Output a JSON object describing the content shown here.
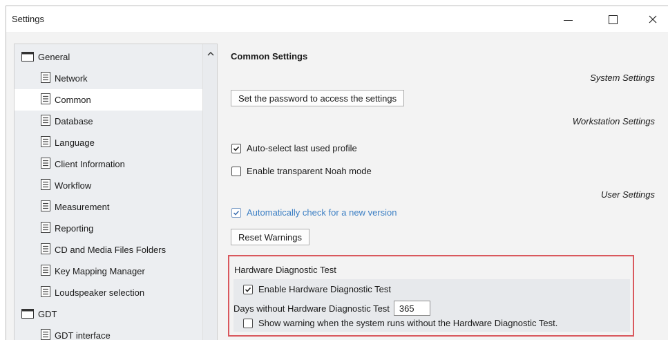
{
  "window": {
    "title": "Settings"
  },
  "tree": {
    "items": [
      {
        "label": "General",
        "type": "folder",
        "level": 0
      },
      {
        "label": "Network",
        "type": "page",
        "level": 1
      },
      {
        "label": "Common",
        "type": "page",
        "level": 1,
        "selected": true
      },
      {
        "label": "Database",
        "type": "page",
        "level": 1
      },
      {
        "label": "Language",
        "type": "page",
        "level": 1
      },
      {
        "label": "Client Information",
        "type": "page",
        "level": 1
      },
      {
        "label": "Workflow",
        "type": "page",
        "level": 1
      },
      {
        "label": "Measurement",
        "type": "page",
        "level": 1
      },
      {
        "label": "Reporting",
        "type": "page",
        "level": 1
      },
      {
        "label": "CD and Media Files Folders",
        "type": "page",
        "level": 1
      },
      {
        "label": "Key Mapping Manager",
        "type": "page",
        "level": 1
      },
      {
        "label": "Loudspeaker selection",
        "type": "page",
        "level": 1
      },
      {
        "label": "GDT",
        "type": "folder",
        "level": 0
      },
      {
        "label": "GDT interface",
        "type": "page",
        "level": 1
      }
    ]
  },
  "content": {
    "section_title": "Common Settings",
    "system_settings_label": "System Settings",
    "set_password_button": "Set the password to access the settings",
    "workstation_settings_label": "Workstation Settings",
    "auto_select_label": "Auto-select last used profile",
    "auto_select_checked": true,
    "noah_mode_label": "Enable transparent Noah mode",
    "noah_mode_checked": false,
    "user_settings_label": "User Settings",
    "auto_check_label": "Automatically check for a new version",
    "auto_check_checked": true,
    "reset_warnings_button": "Reset Warnings"
  },
  "hardware": {
    "title": "Hardware Diagnostic Test",
    "enable_label": "Enable Hardware Diagnostic Test",
    "enable_checked": true,
    "days_label": "Days without Hardware Diagnostic Test",
    "days_value": "365",
    "warning_label": "Show warning when the system runs without the Hardware Diagnostic Test.",
    "warning_checked": false
  },
  "colors": {
    "highlight_border": "#d9585d",
    "link_blue": "#3c7fc4"
  }
}
